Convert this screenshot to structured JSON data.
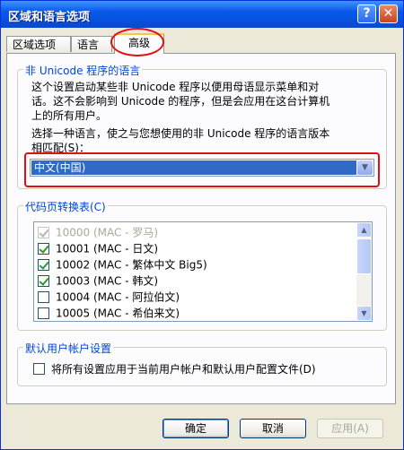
{
  "window": {
    "title": "区域和语言选项",
    "help_label": "?",
    "close_label": "✕"
  },
  "tabs": [
    {
      "label": "区域选项"
    },
    {
      "label": "语言"
    },
    {
      "label": "高级"
    }
  ],
  "unicode_group": {
    "title": "非 Unicode 程序的语言",
    "description_lines": [
      "这个设置启动某些非 Unicode 程序以便用母语显示菜单和对",
      "话。这不会影响到 Unicode 的程序，但是会应用在这台计算机",
      "上的所有用户。"
    ],
    "select_lines": [
      "选择一种语言，使之与您想使用的非 Unicode 程序的语言版本",
      "相匹配(S)："
    ],
    "selected_language": "中文(中国)"
  },
  "codepage_group": {
    "title": "代码页转换表(C)",
    "items": [
      {
        "text": "10000  (MAC - 罗马)",
        "checked": true,
        "disabled": true
      },
      {
        "text": "10001  (MAC - 日文)",
        "checked": true,
        "disabled": false
      },
      {
        "text": "10002  (MAC - 繁体中文 Big5)",
        "checked": true,
        "disabled": false
      },
      {
        "text": "10003  (MAC - 韩文)",
        "checked": true,
        "disabled": false
      },
      {
        "text": "10004  (MAC - 阿拉伯文)",
        "checked": false,
        "disabled": false
      },
      {
        "text": "10005  (MAC - 希伯来文)",
        "checked": false,
        "disabled": false
      }
    ]
  },
  "default_user_group": {
    "title": "默认用户帐户设置",
    "checkbox_label": "将所有设置应用于当前用户帐户和默认用户配置文件(D)"
  },
  "buttons": {
    "ok": "确定",
    "cancel": "取消",
    "apply": "应用(A)"
  }
}
